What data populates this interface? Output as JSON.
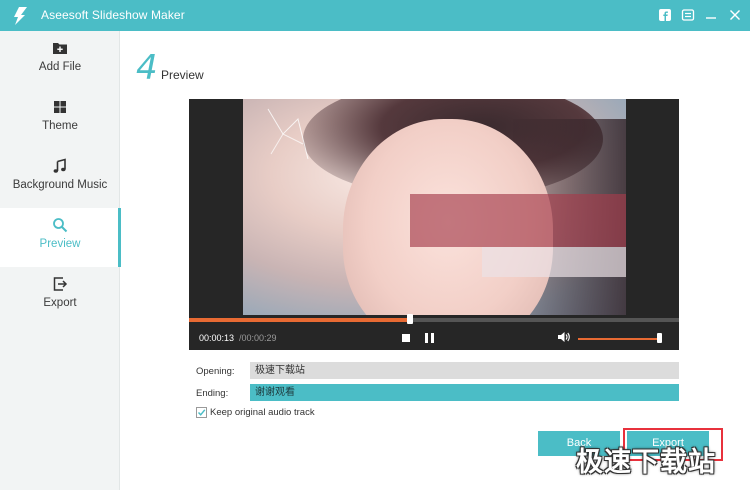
{
  "window": {
    "title": "Aseesoft Slideshow Maker",
    "icons": [
      "app-logo-icon",
      "facebook-icon",
      "menu-icon",
      "minimize-icon",
      "close-icon"
    ]
  },
  "sidebar": {
    "items": [
      {
        "label": "Add File",
        "icon": "add-file-icon",
        "active": false
      },
      {
        "label": "Theme",
        "icon": "theme-grid-icon",
        "active": false
      },
      {
        "label": "Background Music",
        "icon": "music-note-icon",
        "active": false
      },
      {
        "label": "Preview",
        "icon": "search-icon",
        "active": true
      },
      {
        "label": "Export",
        "icon": "export-icon",
        "active": false
      }
    ]
  },
  "step": {
    "number": "4",
    "title": "Preview"
  },
  "player": {
    "current_time": "00:00:13",
    "total_time": "/00:00:29",
    "progress": 0.45,
    "volume": 0.98
  },
  "fields": {
    "opening_label": "Opening:",
    "opening_value": "极速下载站",
    "ending_label": "Ending:",
    "ending_value": "谢谢观看"
  },
  "options": {
    "keep_audio_label": "Keep original audio track",
    "keep_audio_checked": true
  },
  "actions": {
    "back_label": "Back",
    "export_label": "Export"
  },
  "watermark": "极速下载站",
  "colors": {
    "accent": "#4bbdc6",
    "progress": "#e86a33",
    "highlight": "#e8313c"
  }
}
